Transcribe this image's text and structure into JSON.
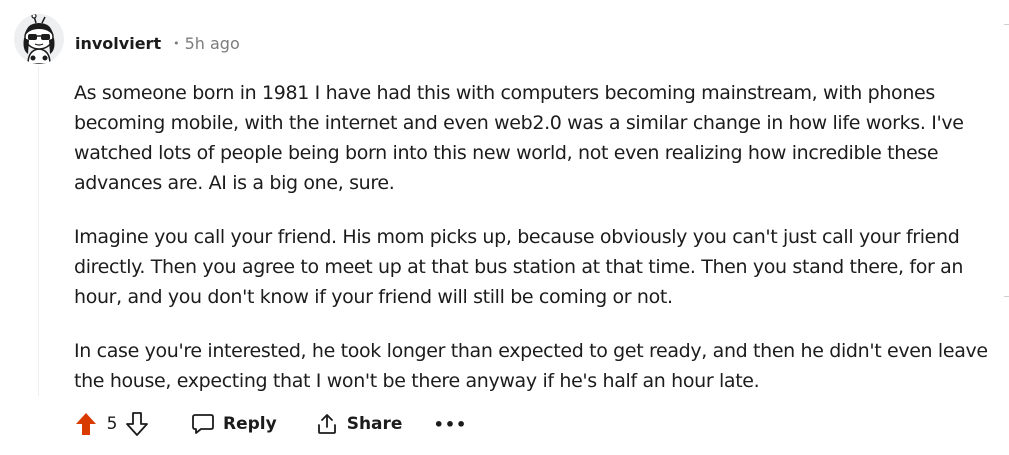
{
  "comment": {
    "username": "involviert",
    "separator": "•",
    "time_ago": "5h ago",
    "paragraphs": [
      "As someone born in 1981 I have had this with computers becoming mainstream, with phones becoming mobile, with the internet and even web2.0 was a similar change in how life works. I've watched lots of people being born into this new world, not even realizing how incredible these advances are. AI is a big one, sure.",
      "Imagine you call your friend. His mom picks up, because obviously you can't just call your friend directly. Then you agree to meet up at that bus station at that time. Then you stand there, for an hour, and you don't know if your friend will still be coming or not.",
      "In case you're interested, he took longer than expected to get ready, and then he didn't even leave the house, expecting that I won't be there anyway if he's half an hour late."
    ]
  },
  "actions": {
    "score": "5",
    "reply_label": "Reply",
    "share_label": "Share",
    "more_label": "•••"
  },
  "icons": {
    "upvote": "upvote-arrow-icon",
    "downvote": "downvote-arrow-icon",
    "reply": "speech-bubble-icon",
    "share": "share-icon",
    "avatar": "snoo-sunglasses-avatar"
  },
  "colors": {
    "upvote_active": "#d93a00",
    "text": "#1c1c1c",
    "muted": "#7c7c7c"
  }
}
